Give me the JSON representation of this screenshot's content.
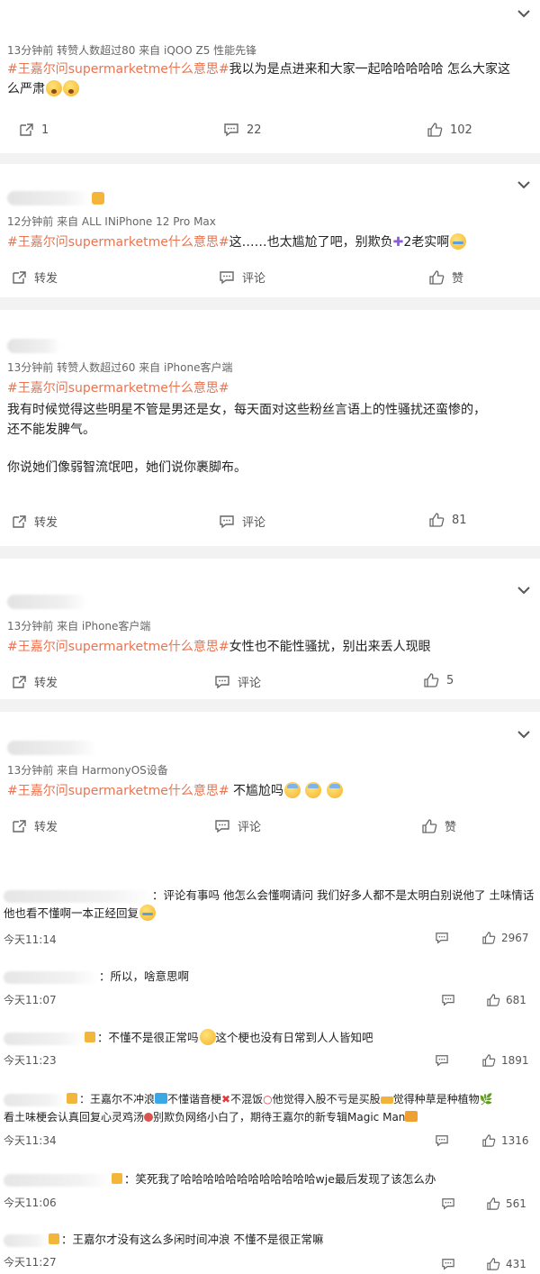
{
  "posts": [
    {
      "meta": "13分钟前  转赞人数超过80  来自 iQOO Z5 性能先锋",
      "tag": "#王嘉尔问supermarketme什么意思#",
      "text_line1": "我以为是点进来和大家一起哈哈哈哈哈 怎么大家这",
      "text_line2": "么严肃",
      "repost": "1",
      "comment": "22",
      "like": "102"
    },
    {
      "meta": "12分钟前  来自 ALL INiPhone 12 Pro Max",
      "tag": "#王嘉尔问supermarketme什么意思#",
      "text_a": "这……也太尴尬了吧，别欺负",
      "text_b": "2老实啊",
      "repost": "转发",
      "comment": "评论",
      "like": "赞"
    },
    {
      "meta": "13分钟前  转赞人数超过60  来自 iPhone客户端",
      "tag": "#王嘉尔问supermarketme什么意思#",
      "para1_line1": "我有时候觉得这些明星不管是男还是女，每天面对这些粉丝言语上的性骚扰还蛮惨的，",
      "para1_line2": "还不能发脾气。",
      "para2": "你说她们像弱智流氓吧，她们说你裹脚布。",
      "repost": "转发",
      "comment": "评论",
      "like": "81"
    },
    {
      "meta": "13分钟前  来自 iPhone客户端",
      "tag": "#王嘉尔问supermarketme什么意思#",
      "text": "女性也不能性骚扰，别出来丢人现眼",
      "repost": "转发",
      "comment": "评论",
      "like": "5"
    },
    {
      "meta": "13分钟前  来自 HarmonyOS设备",
      "tag": "#王嘉尔问supermarketme什么意思#",
      "text": " 不尴尬吗",
      "repost": "转发",
      "comment": "评论",
      "like": "赞"
    }
  ],
  "comments": [
    {
      "line1": "：评论有事吗 他怎么会懂啊请问 我们好多人都不是太明白别说他了 土味情话",
      "line2": "他也看不懂啊一本正经回复",
      "time": "今天11:14",
      "likes": "2967"
    },
    {
      "line1": "：所以，啥意思啊",
      "time": "今天11:07",
      "likes": "681"
    },
    {
      "line1": "：不懂不是很正常吗",
      "line1b": "这个梗也没有日常到人人皆知吧",
      "time": "今天11:23",
      "likes": "1891"
    },
    {
      "line1a": "：王嘉尔不冲浪",
      "line1b": "不懂谐音梗",
      "line1c": "不混饭",
      "line1d": "他觉得入股不亏是买股",
      "line1e": "觉得种草是种植物",
      "line2a": "看土味梗会认真回复心灵鸡汤",
      "line2b": "别欺负网络小白了，期待王嘉尔的新专辑Magic Man",
      "time": "今天11:34",
      "likes": "1316"
    },
    {
      "line1": "：笑死我了哈哈哈哈哈哈哈哈哈哈哈哈wje最后发现了该怎么办",
      "time": "今天11:06",
      "likes": "561"
    },
    {
      "line1": "：王嘉尔才没有这么多闲时间冲浪 不懂不是很正常嘛",
      "time": "今天11:27",
      "likes": "431"
    }
  ]
}
